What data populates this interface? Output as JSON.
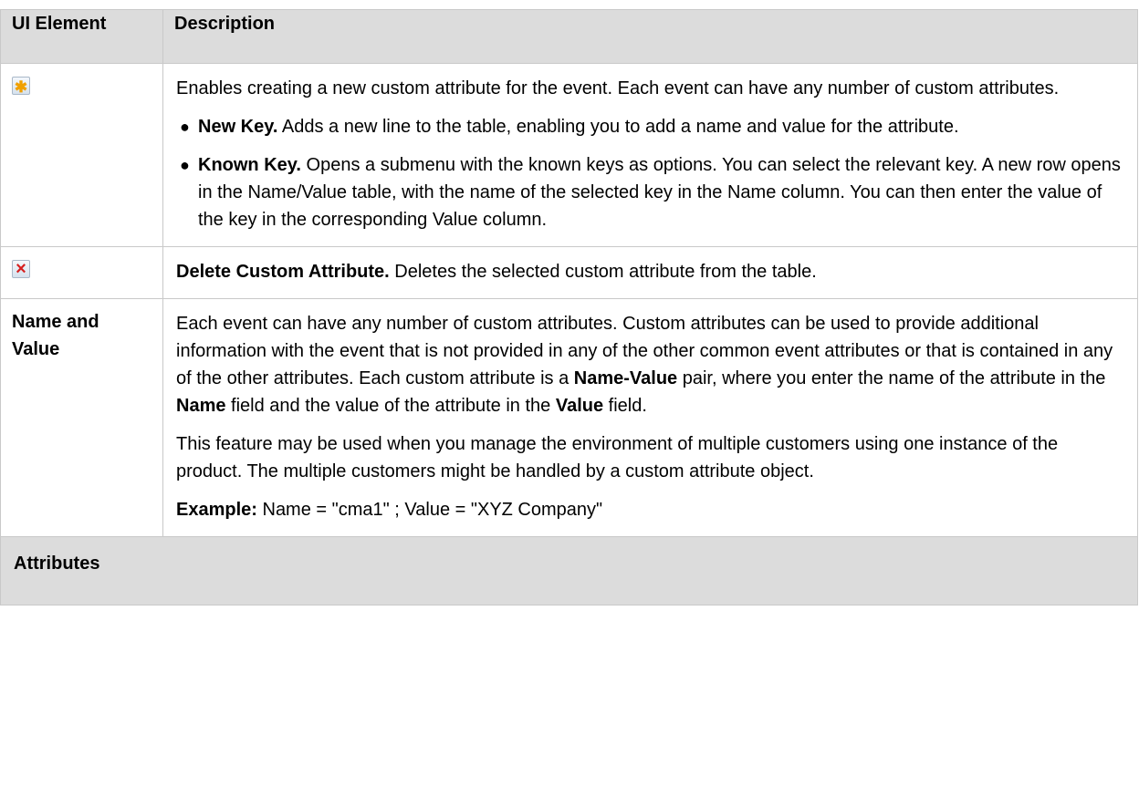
{
  "table": {
    "header": {
      "col1": "UI Element",
      "col2": "Description"
    },
    "row_new": {
      "icon": "new-attribute-icon",
      "intro": "Enables creating a new custom attribute for the event. Each event can have any number of custom attributes.",
      "bullets": [
        {
          "term": "New Key.",
          "text": " Adds a new line to the table, enabling you to add a name and value for the attribute."
        },
        {
          "term": "Known Key.",
          "text": " Opens a submenu with the known keys as options. You can select the relevant key. A new row opens in the Name/Value table, with the name of the selected key in the Name column. You can then enter the value of the key in the corresponding Value column."
        }
      ]
    },
    "row_delete": {
      "icon": "delete-attribute-icon",
      "term": "Delete Custom Attribute.",
      "text": " Deletes the selected custom attribute from the table."
    },
    "row_name_value": {
      "label": "Name and Value",
      "p1_a": "Each event can have any number of custom attributes. Custom attributes can be used to provide additional information with the event that is not provided in any of the other common event attributes or that is contained in any of the other attributes. Each custom attribute is a ",
      "p1_b1": "Name-Value",
      "p1_c": " pair, where you enter the name of the attribute in the ",
      "p1_b2": "Name",
      "p1_d": " field and the value of the attribute in the ",
      "p1_b3": "Value",
      "p1_e": " field.",
      "p2": "This feature may be used when you manage the environment of multiple customers using one instance of the product. The multiple customers might be handled by a custom attribute object.",
      "p3_term": "Example:",
      "p3_text": " Name = \"cma1\" ; Value = \"XYZ Company\""
    },
    "section": "Attributes"
  },
  "colors": {
    "header_bg": "#dcdcdc",
    "border": "#c9c9c9",
    "new_icon": "#f0a000",
    "delete_icon": "#d62020"
  }
}
